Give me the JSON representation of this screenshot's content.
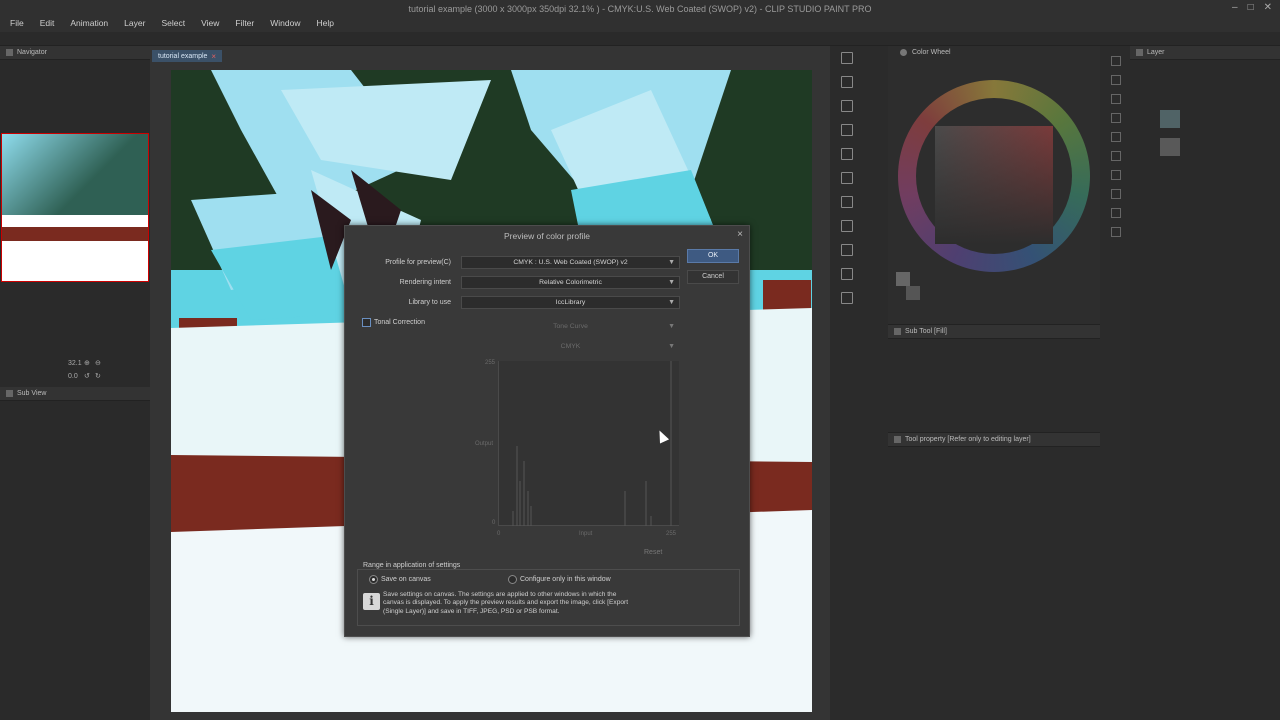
{
  "window": {
    "title": "tutorial example (3000 x 3000px 350dpi 32.1% ) - CMYK:U.S. Web Coated (SWOP) v2) - CLIP STUDIO PAINT PRO"
  },
  "menu": {
    "items": [
      "File",
      "Edit",
      "Animation",
      "Layer",
      "Select",
      "View",
      "Filter",
      "Window",
      "Help"
    ]
  },
  "left_panel": {
    "navigator_tab": "Navigator",
    "zoom_value": "32.1",
    "rotation_value": "0.0",
    "subview_tab": "Sub View"
  },
  "canvas": {
    "tab_label": "tutorial example"
  },
  "color_panel": {
    "tab_label": "Color Wheel"
  },
  "sub_tool": {
    "tab_label": "Sub Tool [Fill]"
  },
  "tool_property": {
    "tab_label": "Tool property [Refer only to editing layer]"
  },
  "layer_panel": {
    "tab_label": "Layer"
  },
  "dialog": {
    "title": "Preview of color profile",
    "ok_label": "OK",
    "cancel_label": "Cancel",
    "profile_label": "Profile for preview(C)",
    "profile_value": "CMYK : U.S. Web Coated (SWOP) v2",
    "intent_label": "Rendering intent",
    "intent_value": "Relative Colorimetric",
    "library_label": "Library to use",
    "library_value": "IccLibrary",
    "tonal_label": "Tonal Correction",
    "tone_curve_value": "Tone Curve",
    "channel_value": "CMYK",
    "graph": {
      "y_max": "255",
      "y_label": "Output",
      "y_min": "0",
      "x_min": "0",
      "x_label": "Input",
      "x_max": "255"
    },
    "reset_label": "Reset",
    "range_legend": "Range in application of settings",
    "radio_save": "Save on canvas",
    "radio_config": "Configure only in this window",
    "info_text": "Save settings on canvas. The settings are applied to other windows in which the canvas is displayed. To apply the preview results and export the image, click [Export (Single Layer)] and save in TIFF, JPEG, PSD or PSB format."
  },
  "colors": {
    "accent": "#3e5a82",
    "sky": "#5fd3e3",
    "forest": "#1f3a24",
    "trunk": "#7a2a1f",
    "snow": "#e9f6f8"
  }
}
